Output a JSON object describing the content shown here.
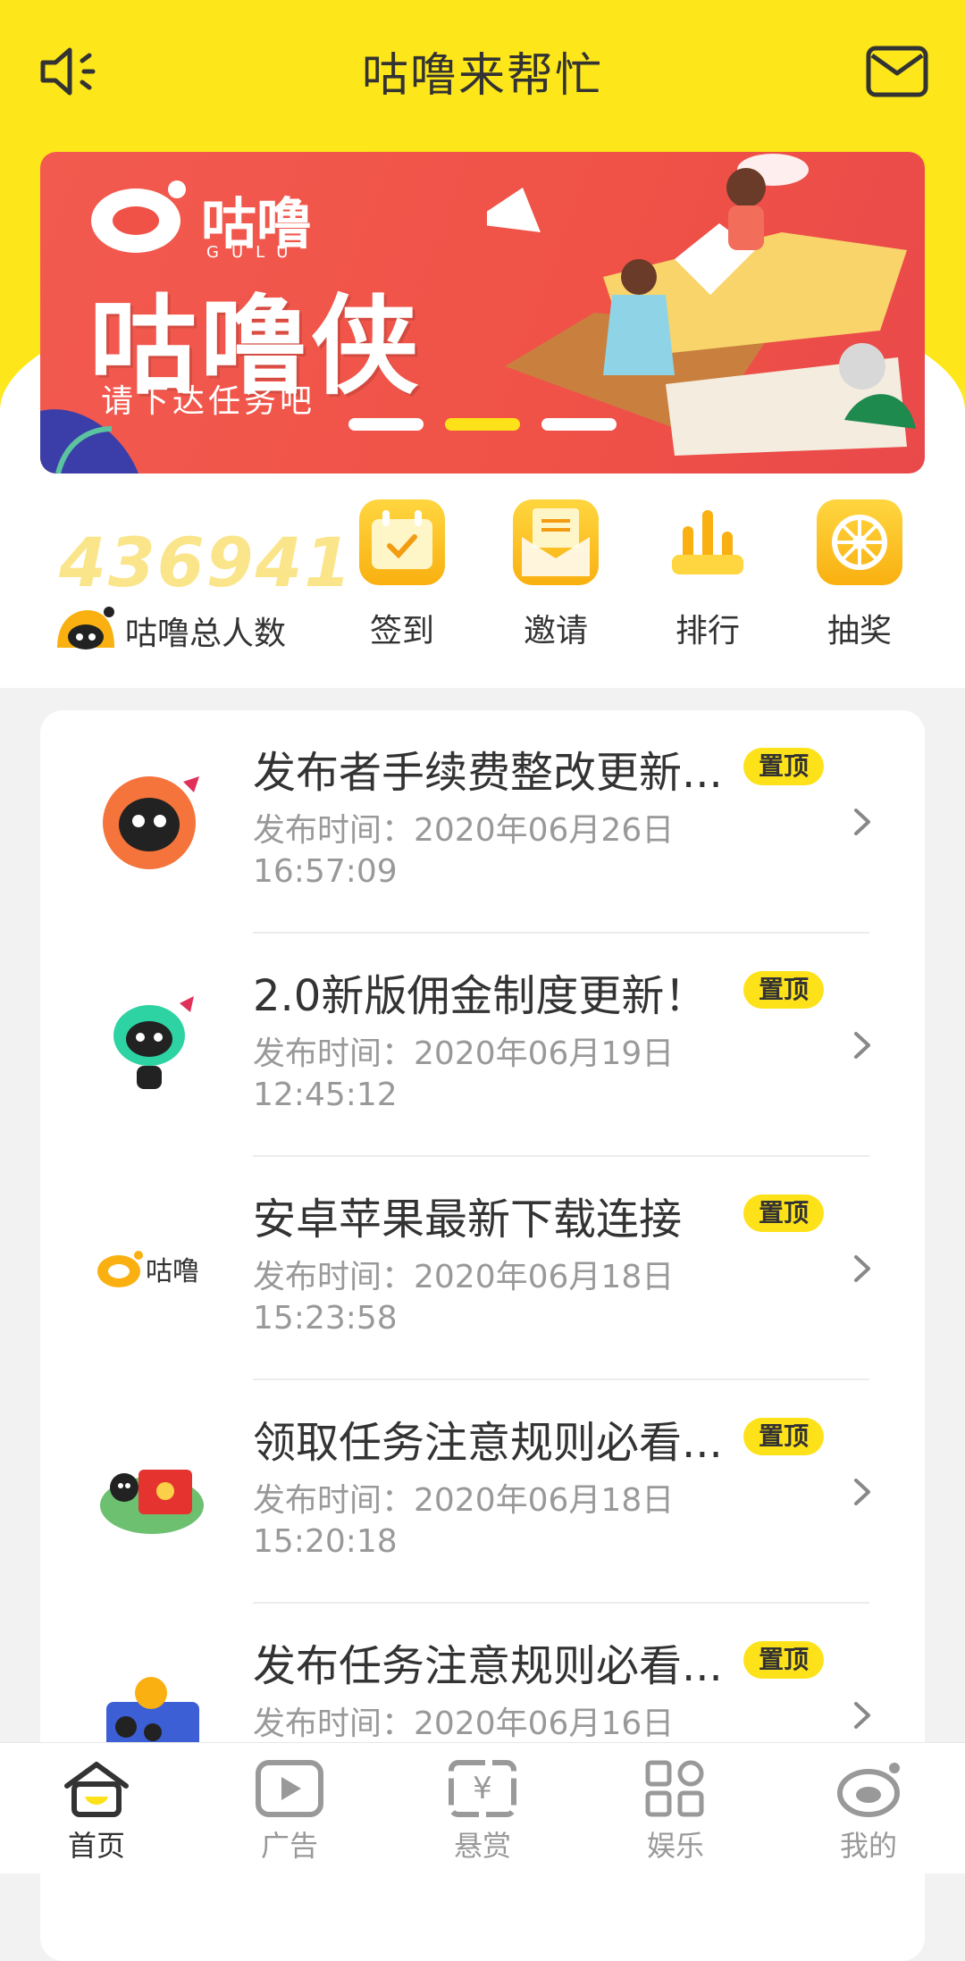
{
  "header": {
    "title": "咕噜来帮忙"
  },
  "banner": {
    "logo_text": "咕噜",
    "logo_sub": "GULU",
    "main_text": "咕噜侠",
    "sub_text": "请下达任务吧"
  },
  "stats": {
    "count": "436941",
    "label": "咕噜总人数"
  },
  "quick_actions": [
    {
      "label": "签到",
      "icon": "calendar-check-icon"
    },
    {
      "label": "邀请",
      "icon": "envelope-invite-icon"
    },
    {
      "label": "排行",
      "icon": "ranking-icon"
    },
    {
      "label": "抽奖",
      "icon": "wheel-icon"
    }
  ],
  "notices": [
    {
      "title": "发布者手续费整改更新...",
      "badge": "置顶",
      "time_line1": "发布时间：2020年06月26日",
      "time_line2": "16:57:09"
    },
    {
      "title": "2.0新版佣金制度更新！",
      "badge": "置顶",
      "time_line1": "发布时间：2020年06月19日",
      "time_line2": "12:45:12"
    },
    {
      "title": "安卓苹果最新下载连接",
      "badge": "置顶",
      "time_line1": "发布时间：2020年06月18日",
      "time_line2": "15:23:58"
    },
    {
      "title": "领取任务注意规则必看...",
      "badge": "置顶",
      "time_line1": "发布时间：2020年06月18日",
      "time_line2": "15:20:18"
    },
    {
      "title": "发布任务注意规则必看...",
      "badge": "置顶",
      "time_line1": "发布时间：2020年06月16日",
      "time_line2": ""
    }
  ],
  "tabbar": [
    {
      "label": "首页",
      "active": true
    },
    {
      "label": "广告",
      "active": false
    },
    {
      "label": "悬赏",
      "active": false
    },
    {
      "label": "娱乐",
      "active": false
    },
    {
      "label": "我的",
      "active": false
    }
  ],
  "colors": {
    "brand_yellow": "#fde21a",
    "banner_red": "#f05247",
    "text_dark": "#333333",
    "text_gray": "#999999"
  }
}
